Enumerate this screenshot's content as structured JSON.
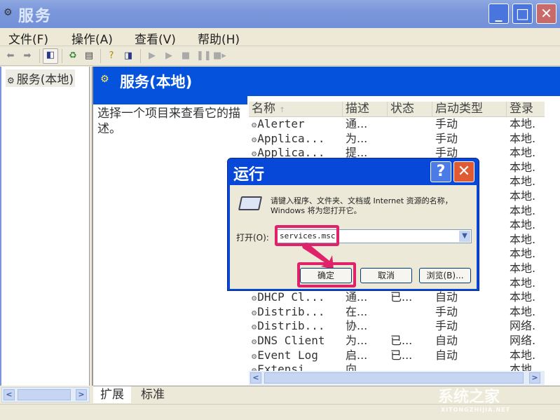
{
  "window": {
    "title": "服务",
    "controls": {
      "minimize": "_",
      "maximize": "□",
      "close": "✕"
    }
  },
  "menu": [
    "文件(F)",
    "操作(A)",
    "查看(V)",
    "帮助(H)"
  ],
  "toolbar": {
    "icons": [
      "back-icon",
      "forward-icon",
      "show-hide-tree-icon",
      "refresh-icon",
      "export-list-icon",
      "help-icon",
      "console-icon",
      "start-service-icon",
      "start-service-alt-icon",
      "stop-service-icon",
      "pause-service-icon",
      "restart-service-icon"
    ]
  },
  "tree": {
    "root": "服务(本地)"
  },
  "panel": {
    "banner_title": "服务(本地)",
    "description": "选择一个项目来查看它的描述。"
  },
  "list": {
    "columns": [
      "名称",
      "描述",
      "状态",
      "启动类型",
      "登录"
    ],
    "sort_indicator": "↑",
    "rows": [
      {
        "name": "Alerter",
        "desc": "通...",
        "status": "",
        "startup": "手动",
        "logon": "本地."
      },
      {
        "name": "Applica...",
        "desc": "为...",
        "status": "",
        "startup": "手动",
        "logon": "本地."
      },
      {
        "name": "Applica...",
        "desc": "提...",
        "status": "",
        "startup": "手动",
        "logon": "本地."
      },
      {
        "name": "",
        "desc": "",
        "status": "",
        "startup": "",
        "logon": "本地."
      },
      {
        "name": "",
        "desc": "",
        "status": "",
        "startup": "",
        "logon": "本地."
      },
      {
        "name": "",
        "desc": "",
        "status": "",
        "startup": "",
        "logon": "本地."
      },
      {
        "name": "",
        "desc": "",
        "status": "",
        "startup": "",
        "logon": "本地."
      },
      {
        "name": "",
        "desc": "",
        "status": "",
        "startup": "",
        "logon": "本地."
      },
      {
        "name": "",
        "desc": "",
        "status": "",
        "startup": "",
        "logon": "本地."
      },
      {
        "name": "",
        "desc": "",
        "status": "",
        "startup": "",
        "logon": "本地."
      },
      {
        "name": "",
        "desc": "",
        "status": "",
        "startup": "",
        "logon": "本地."
      },
      {
        "name": "",
        "desc": "",
        "status": "",
        "startup": "",
        "logon": "本地."
      },
      {
        "name": "DHCP Cl...",
        "desc": "通...",
        "status": "已...",
        "startup": "自动",
        "logon": "本地."
      },
      {
        "name": "Distrib...",
        "desc": "在...",
        "status": "",
        "startup": "手动",
        "logon": "本地."
      },
      {
        "name": "Distrib...",
        "desc": "协...",
        "status": "",
        "startup": "手动",
        "logon": "网络."
      },
      {
        "name": "DNS Client",
        "desc": "为...",
        "status": "已...",
        "startup": "自动",
        "logon": "网络."
      },
      {
        "name": "Event Log",
        "desc": "启...",
        "status": "已...",
        "startup": "自动",
        "logon": "本地."
      },
      {
        "name": "Extensi...",
        "desc": "向...",
        "status": "",
        "startup": "",
        "logon": "本地."
      }
    ]
  },
  "tabs": [
    "扩展",
    "标准"
  ],
  "run_dialog": {
    "title": "运行",
    "help": "?",
    "close": "✕",
    "message": "请键入程序、文件夹、文档或 Internet 资源的名称，Windows 将为您打开它。",
    "open_label": "打开(O):",
    "open_value": "services.msc",
    "ok_label": "确定",
    "cancel_label": "取消",
    "browse_label": "浏览(B)...",
    "highlight_color": "#e0226a"
  },
  "watermark": {
    "text": "系统之家",
    "sub": "XITONGZHIJIA.NET"
  }
}
